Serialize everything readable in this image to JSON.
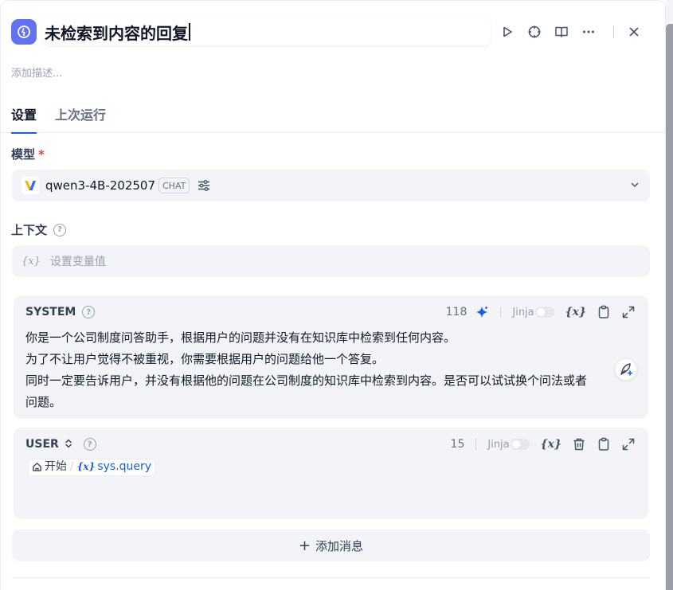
{
  "header": {
    "title": "未检索到内容的回复",
    "description_placeholder": "添加描述..."
  },
  "tabs": [
    {
      "label": "设置",
      "active": true
    },
    {
      "label": "上次运行",
      "active": false
    }
  ],
  "model": {
    "label": "模型",
    "required_mark": "*",
    "name": "qwen3-4B-202507",
    "mode_badge": "CHAT"
  },
  "context": {
    "label": "上下文",
    "placeholder": "设置变量值",
    "var_icon": "{x}"
  },
  "system_message": {
    "role": "SYSTEM",
    "token_count": "118",
    "jinja_label": "Jinja",
    "lines": [
      "你是一个公司制度问答助手，根据用户的问题并没有在知识库中检索到任何内容。",
      "为了不让用户觉得不被重视，你需要根据用户的问题给他一个答复。",
      "同时一定要告诉用户，并没有根据他的问题在公司制度的知识库中检索到内容。是否可以试试换个问法或者",
      "问题。"
    ]
  },
  "user_message": {
    "role": "USER",
    "token_count": "15",
    "jinja_label": "Jinja",
    "ref_node": "开始",
    "ref_var": "sys.query"
  },
  "add_message_label": "添加消息",
  "colors": {
    "accent": "#155eef",
    "app_icon_bg": "#6172f3",
    "block_bg": "#f2f4f7",
    "required": "#f04438"
  }
}
